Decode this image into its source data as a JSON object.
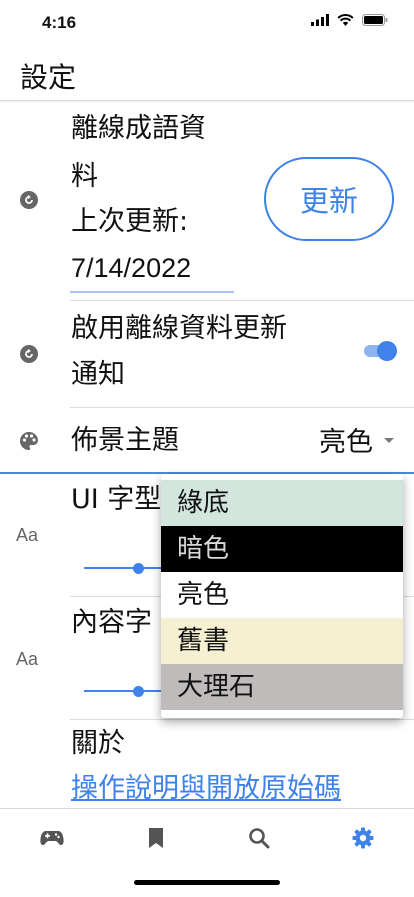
{
  "status": {
    "time": "4:16"
  },
  "header": {
    "title": "設定"
  },
  "offline": {
    "line1": "離線成語資",
    "line2": "料",
    "line3": "上次更新:",
    "line4": "7/14/2022",
    "button_label": "更新"
  },
  "notify": {
    "line1": "啟用離線資料更新",
    "line2": "通知",
    "enabled": true
  },
  "theme": {
    "label": "佈景主題",
    "selected": "亮色",
    "options": [
      {
        "label": "綠底",
        "bg": "#d3e6dd",
        "fg": "#111111"
      },
      {
        "label": "暗色",
        "bg": "#000000",
        "fg": "#d8d8d8"
      },
      {
        "label": "亮色",
        "bg": "#ffffff",
        "fg": "#111111"
      },
      {
        "label": "舊書",
        "bg": "#f5f0d2",
        "fg": "#111111"
      },
      {
        "label": "大理石",
        "bg": "#bfbbba",
        "fg": "#111111"
      }
    ]
  },
  "ui_font": {
    "label": "UI 字型",
    "icon_text": "Aa"
  },
  "content_font": {
    "label": "內容字",
    "icon_text": "Aa"
  },
  "about": {
    "label": "關於",
    "link": "操作說明與開放原始碼"
  },
  "tabs": [
    {
      "name": "game-icon",
      "active": false
    },
    {
      "name": "bookmark-icon",
      "active": false
    },
    {
      "name": "search-icon",
      "active": false
    },
    {
      "name": "settings-icon",
      "active": true
    }
  ],
  "colors": {
    "accent": "#3e82ea",
    "inactive": "#555555"
  }
}
